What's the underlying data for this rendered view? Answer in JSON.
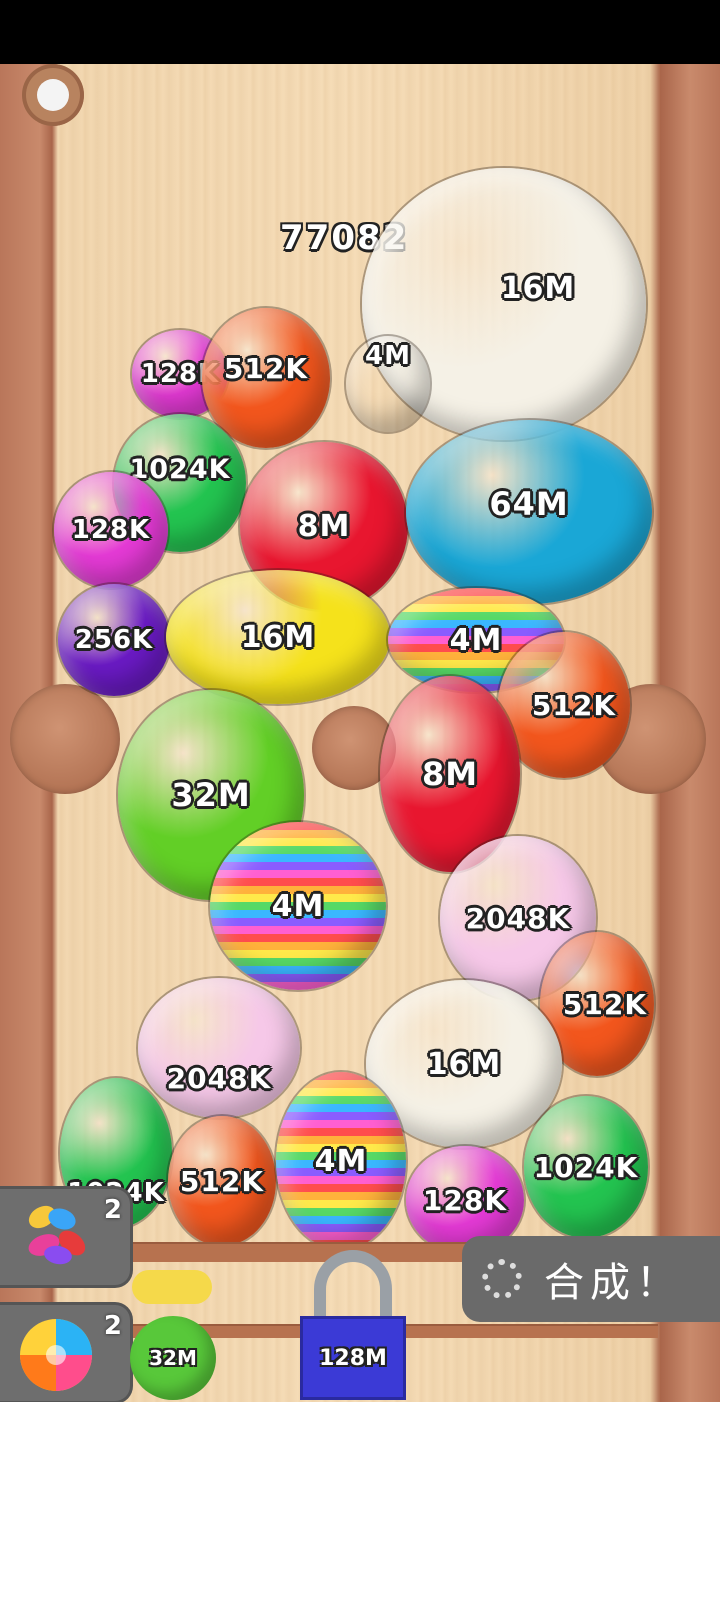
{
  "score": "77082",
  "balls": [
    {
      "label": "16M",
      "color": "#f5f1e6",
      "rainbow": false
    },
    {
      "label": "4M",
      "color": "#ffffff",
      "rainbow": true
    },
    {
      "label": "128K",
      "color": "#e53ad6",
      "rainbow": false
    },
    {
      "label": "512K",
      "color": "#f2561d",
      "rainbow": false
    },
    {
      "label": "1024K",
      "color": "#23c450",
      "rainbow": false
    },
    {
      "label": "8M",
      "color": "#e8162f",
      "rainbow": false
    },
    {
      "label": "64M",
      "color": "#1aa7d6",
      "rainbow": false
    },
    {
      "label": "128K",
      "color": "#e53ad6",
      "rainbow": false
    },
    {
      "label": "256K",
      "color": "#6a1ac4",
      "rainbow": false
    },
    {
      "label": "16M",
      "color": "#f5e21b",
      "rainbow": false
    },
    {
      "label": "4M",
      "color": "#ffffff",
      "rainbow": true
    },
    {
      "label": "512K",
      "color": "#f2561d",
      "rainbow": false
    },
    {
      "label": "32M",
      "color": "#62cf26",
      "rainbow": false
    },
    {
      "label": "8M",
      "color": "#e8162f",
      "rainbow": false
    },
    {
      "label": "4M",
      "color": "#ffffff",
      "rainbow": true
    },
    {
      "label": "2048K",
      "color": "#f6c8e8",
      "rainbow": false
    },
    {
      "label": "512K",
      "color": "#f2561d",
      "rainbow": false
    },
    {
      "label": "2048K",
      "color": "#f6c8e8",
      "rainbow": false
    },
    {
      "label": "16M",
      "color": "#f5f1e6",
      "rainbow": false
    },
    {
      "label": "1024K",
      "color": "#23c450",
      "rainbow": false
    },
    {
      "label": "512K",
      "color": "#f2561d",
      "rainbow": false
    },
    {
      "label": "4M",
      "color": "#ffffff",
      "rainbow": true
    },
    {
      "label": "128K",
      "color": "#e53ad6",
      "rainbow": false
    },
    {
      "label": "1024K",
      "color": "#23c450",
      "rainbow": false
    }
  ],
  "powerups": {
    "candy_count": "2",
    "swirl_count": "2",
    "gift_value": "32M",
    "lock_value": "128M"
  },
  "merge_button": {
    "label": "合成！"
  }
}
